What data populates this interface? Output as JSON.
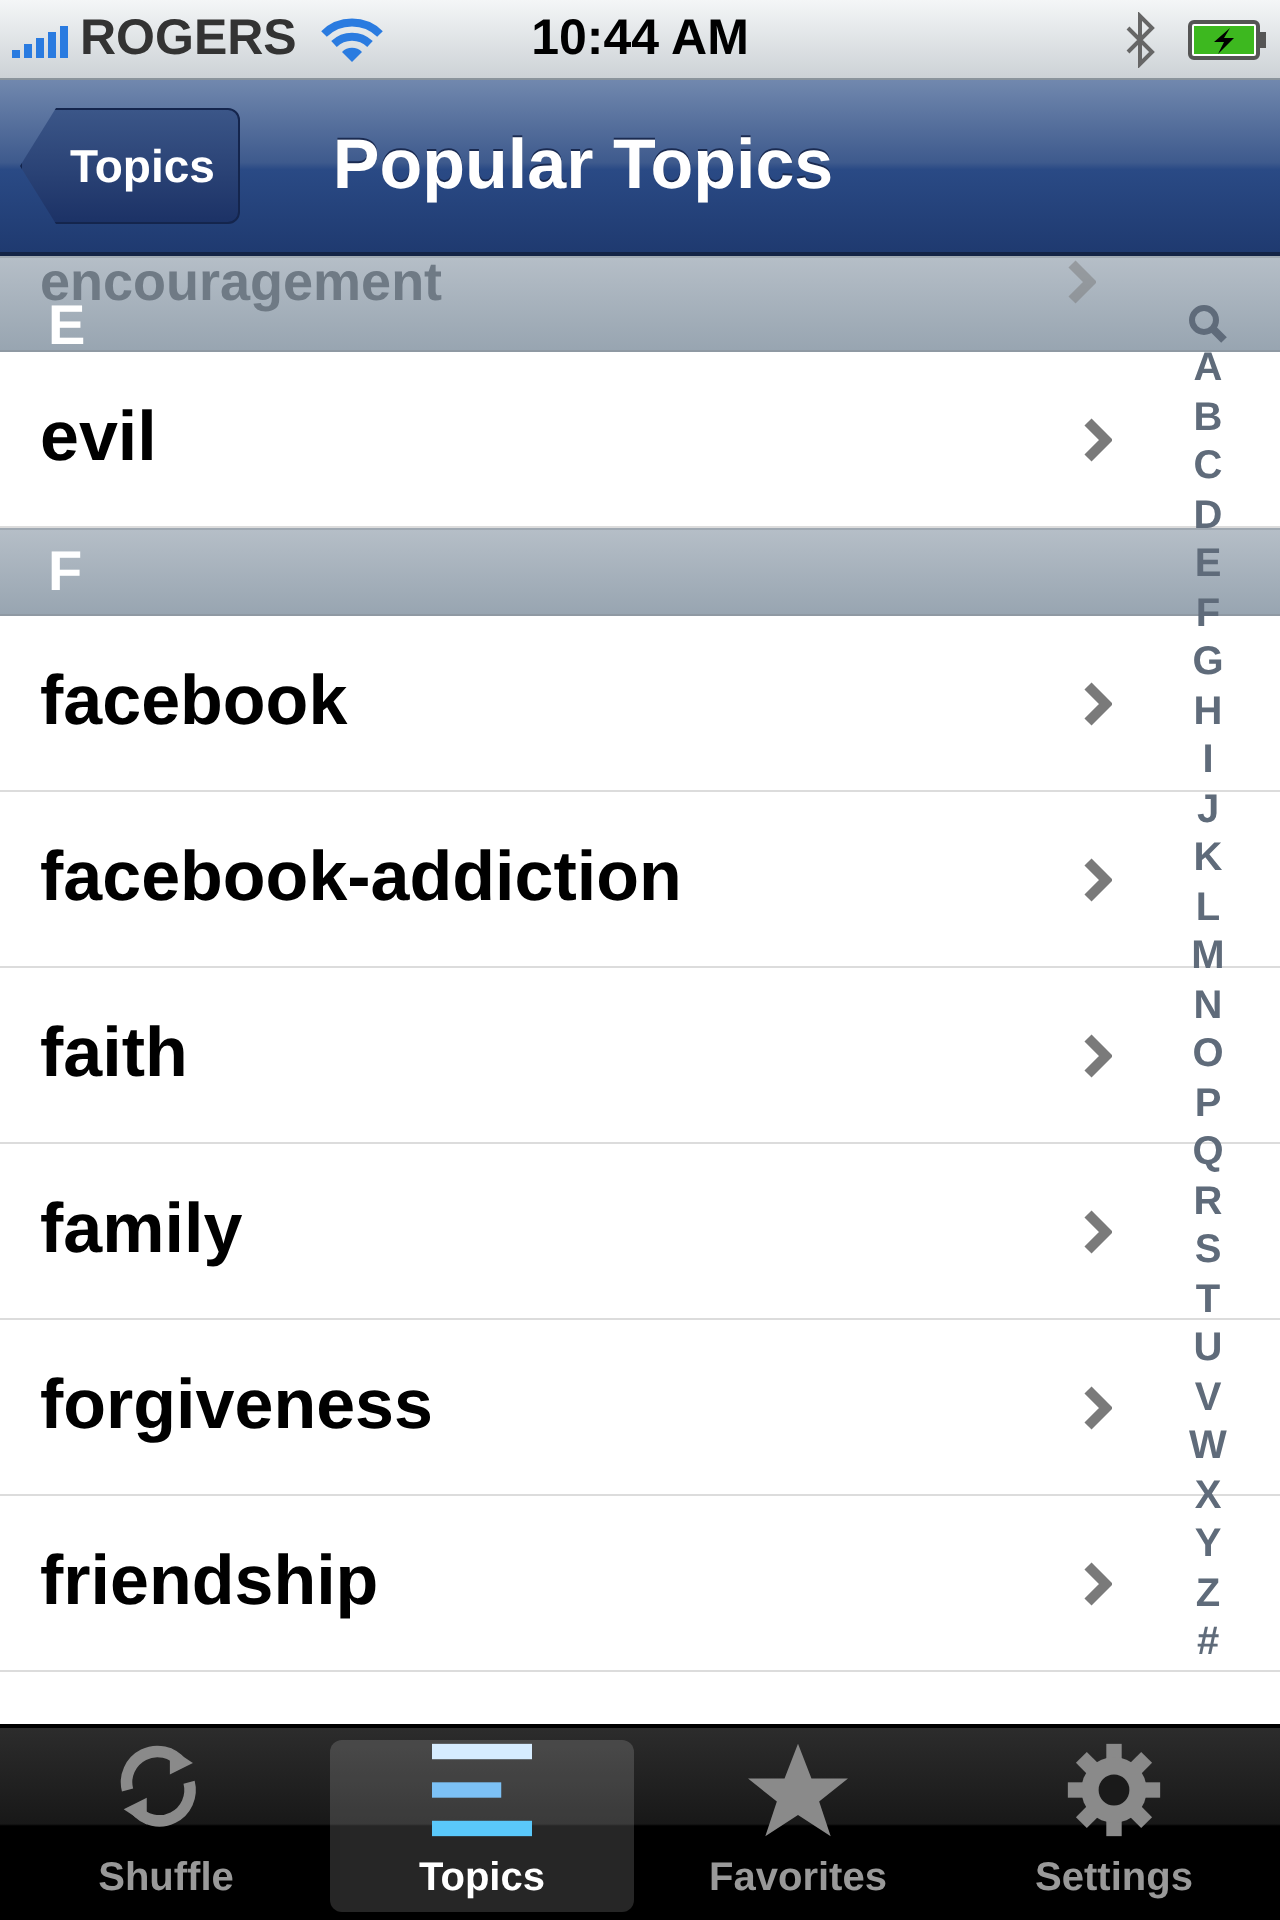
{
  "status_bar": {
    "carrier": "ROGERS",
    "time": "10:44 AM"
  },
  "nav": {
    "back": "Topics",
    "title": "Popular Topics"
  },
  "sections": [
    {
      "header": "E",
      "ghost_row": "encouragement",
      "rows": [
        "evil"
      ]
    },
    {
      "header": "F",
      "rows": [
        "facebook",
        "facebook-addiction",
        "faith",
        "family",
        "forgiveness",
        "friendship"
      ]
    }
  ],
  "index": [
    "A",
    "B",
    "C",
    "D",
    "E",
    "F",
    "G",
    "H",
    "I",
    "J",
    "K",
    "L",
    "M",
    "N",
    "O",
    "P",
    "Q",
    "R",
    "S",
    "T",
    "U",
    "V",
    "W",
    "X",
    "Y",
    "Z",
    "#"
  ],
  "tabs": [
    {
      "kind": "shuffle",
      "label": "Shuffle",
      "selected": false
    },
    {
      "kind": "topics",
      "label": "Topics",
      "selected": true
    },
    {
      "kind": "favorites",
      "label": "Favorites",
      "selected": false
    },
    {
      "kind": "settings",
      "label": "Settings",
      "selected": false
    }
  ]
}
